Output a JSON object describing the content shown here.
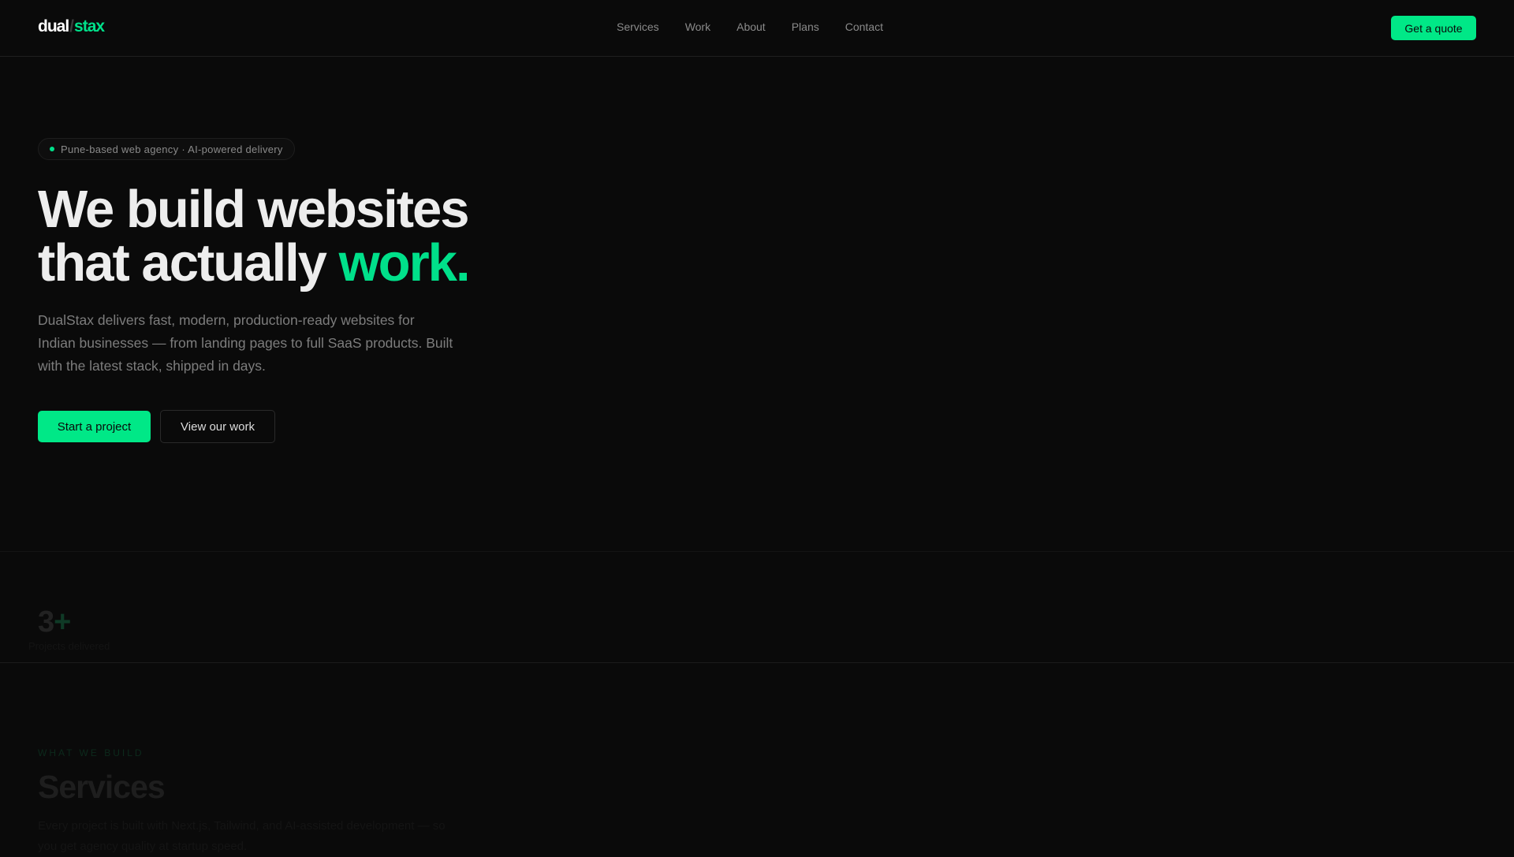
{
  "nav": {
    "logo": {
      "part1": "dual",
      "sep": "/",
      "part2": "stax"
    },
    "links": [
      "Services",
      "Work",
      "About",
      "Plans",
      "Contact"
    ],
    "cta": "Get a quote"
  },
  "hero": {
    "badge": "Pune-based web agency · AI-powered delivery",
    "title_line1": "We build websites",
    "title_line2_prefix": "that actually ",
    "title_highlight": "work.",
    "lead": "DualStax delivers fast, modern, production-ready websites for Indian businesses — from landing pages to full SaaS products. Built with the latest stack, shipped in days.",
    "primary_button": "Start a project",
    "secondary_button": "View our work"
  },
  "stats": {
    "value": "3",
    "suffix": "+",
    "label": "Projects delivered"
  },
  "services": {
    "eyebrow": "WHAT WE BUILD",
    "title": "Services",
    "description": "Every project is built with Next.js, Tailwind, and AI-assisted development — so you get agency quality at startup speed."
  },
  "colors": {
    "accent": "#00e887",
    "background": "#0a0a0a"
  }
}
